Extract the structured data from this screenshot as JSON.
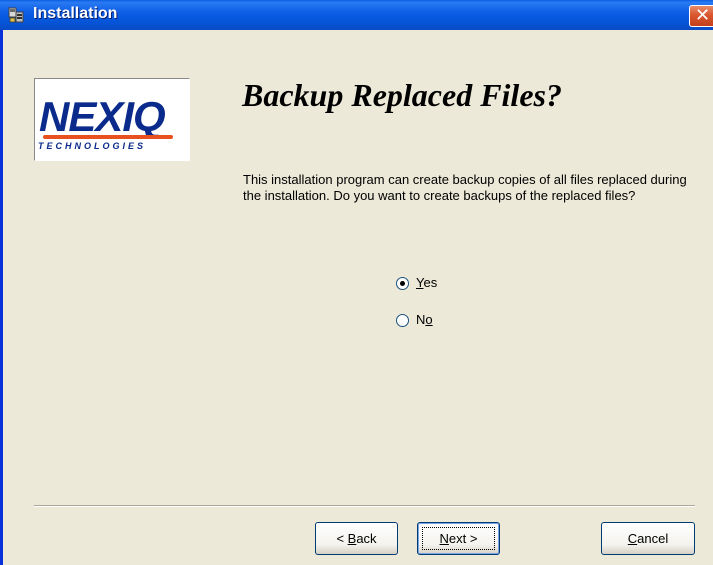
{
  "window": {
    "title": "Installation",
    "close_glyph": "✕"
  },
  "logo": {
    "main": "NEXIQ",
    "sub": "TECHNOLOGIES",
    "color": "#0a2a8c",
    "accent": "#e8501f"
  },
  "page": {
    "heading": "Backup Replaced Files?",
    "description": "This installation program can create backup copies of all files replaced during the installation.  Do you want to create backups of the replaced files?"
  },
  "options": [
    {
      "label": "Yes",
      "selected": true
    },
    {
      "label": "No",
      "selected": false
    }
  ],
  "buttons": {
    "back": "< Back",
    "next": "Next >",
    "cancel": "Cancel"
  },
  "icons": {
    "title": "installer-icon",
    "close": "close-icon"
  }
}
